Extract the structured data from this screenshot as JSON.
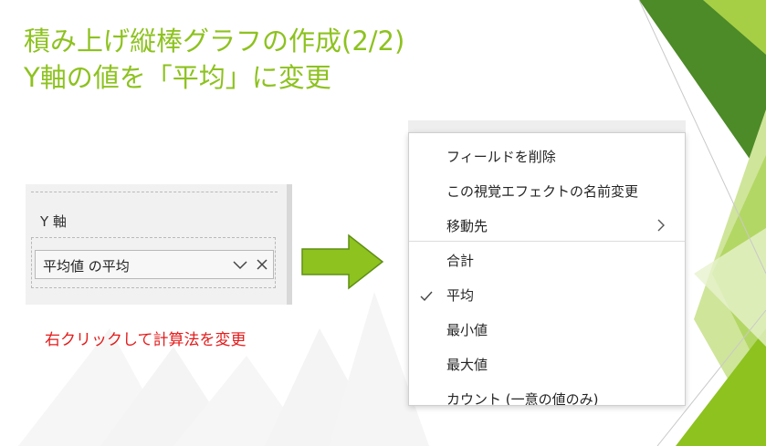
{
  "slide": {
    "title_line1": "積み上げ縦棒グラフの作成(2/2)",
    "title_line2": "Y軸の値を「平均」に変更",
    "accent_color": "#8dc21f"
  },
  "field_pane": {
    "axis_label": "Y 軸",
    "field_value": "平均値 の平均",
    "chevron_icon": "chevron-down-icon",
    "close_icon": "close-icon"
  },
  "caption": "右クリックして計算法を変更",
  "arrow_icon": "right-arrow-icon",
  "context_menu": {
    "items": [
      {
        "label": "フィールドを削除"
      },
      {
        "label": "この視覚エフェクトの名前変更"
      },
      {
        "label": "移動先",
        "submenu": true
      },
      {
        "label": "合計"
      },
      {
        "label": "平均",
        "checked": true
      },
      {
        "label": "最小値"
      },
      {
        "label": "最大値"
      },
      {
        "label": "カウント (一意の値のみ)"
      }
    ]
  }
}
